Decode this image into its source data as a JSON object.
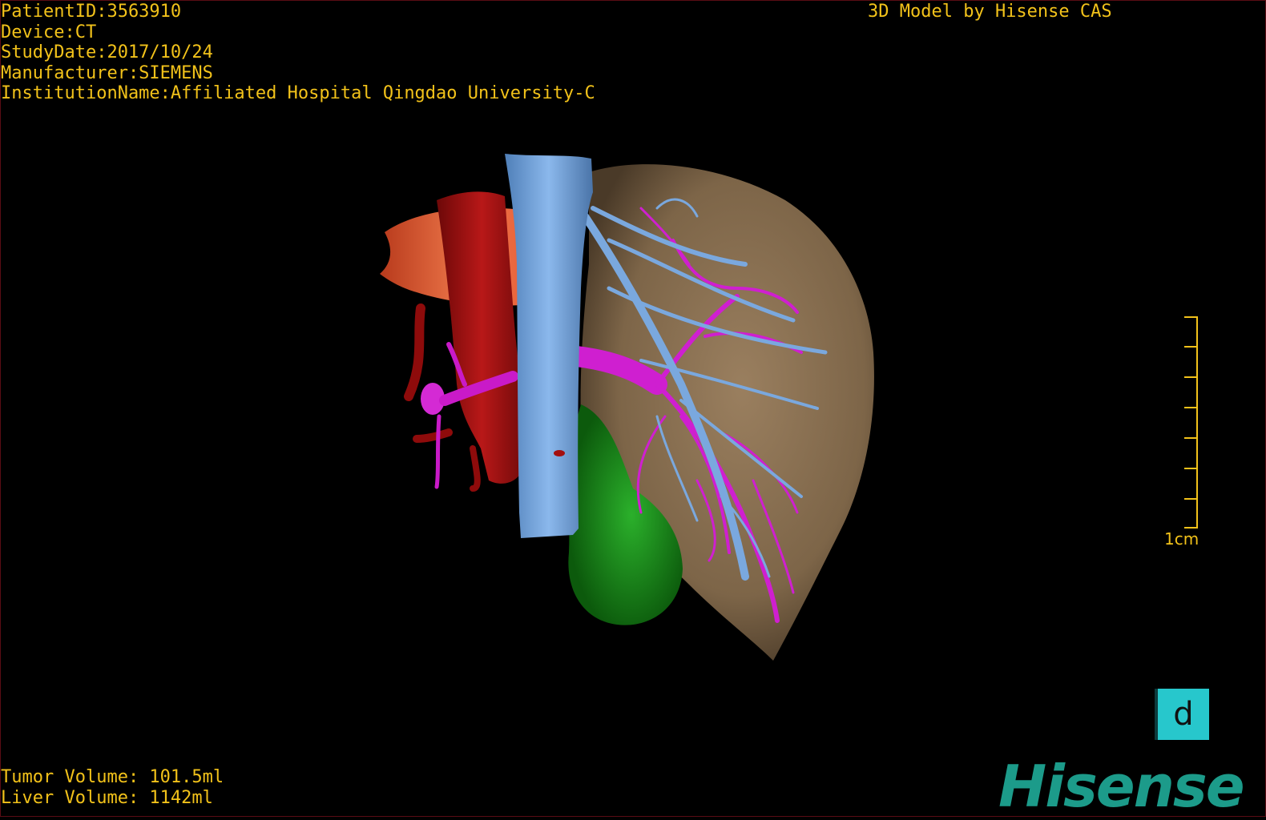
{
  "patient": {
    "id_line": "PatientID:3563910",
    "device_line": "Device:CT",
    "date_line": "StudyDate:2017/10/24",
    "manufacturer_line": "Manufacturer:SIEMENS",
    "institution_line": "InstitutionName:Affiliated Hospital Qingdao University-C"
  },
  "header": {
    "credit": "3D Model by Hisense CAS"
  },
  "volumes": {
    "tumor": "Tumor Volume: 101.5ml",
    "liver": "Liver Volume: 1142ml"
  },
  "scale_bar": {
    "label": "1cm"
  },
  "orientation_cube": {
    "label": "d"
  },
  "brand": {
    "logo_text": "Hisense"
  },
  "colors": {
    "text": "#f2c21a",
    "liver": "#8a7052",
    "vena_cava": "#6f9fd8",
    "aorta": "#a00f0f",
    "portal_vessels": "#d11bd0",
    "tumor": "#1f8f1f",
    "orange_organ": "#e8613a",
    "brand": "#1c9b8a"
  }
}
